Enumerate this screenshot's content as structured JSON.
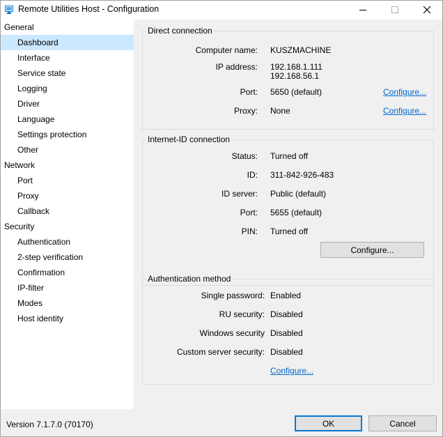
{
  "window": {
    "title": "Remote Utilities Host - Configuration",
    "icon": "remote-utilities-app-icon",
    "controls": [
      "minimize-icon",
      "maximize-icon",
      "close-icon"
    ]
  },
  "sidebar": {
    "items": [
      {
        "label": "General",
        "level": 0
      },
      {
        "label": "Dashboard",
        "level": 1,
        "selected": true
      },
      {
        "label": "Interface",
        "level": 1
      },
      {
        "label": "Service state",
        "level": 1
      },
      {
        "label": "Logging",
        "level": 1
      },
      {
        "label": "Driver",
        "level": 1
      },
      {
        "label": "Language",
        "level": 1
      },
      {
        "label": "Settings protection",
        "level": 1
      },
      {
        "label": "Other",
        "level": 1
      },
      {
        "label": "Network",
        "level": 0
      },
      {
        "label": "Port",
        "level": 1
      },
      {
        "label": "Proxy",
        "level": 1
      },
      {
        "label": "Callback",
        "level": 1
      },
      {
        "label": "Security",
        "level": 0
      },
      {
        "label": "Authentication",
        "level": 1
      },
      {
        "label": "2-step verification",
        "level": 1
      },
      {
        "label": "Confirmation",
        "level": 1
      },
      {
        "label": "IP-filter",
        "level": 1
      },
      {
        "label": "Modes",
        "level": 1
      },
      {
        "label": "Host identity",
        "level": 1
      }
    ]
  },
  "direct_connection": {
    "title": "Direct connection",
    "computer_name_label": "Computer name:",
    "computer_name": "KUSZMACHINE",
    "ip_label": "IP address:",
    "ip_1": "192.168.1.111",
    "ip_2": "192.168.56.1",
    "port_label": "Port:",
    "port": "5650 (default)",
    "port_configure": "Configure...",
    "proxy_label": "Proxy:",
    "proxy": "None",
    "proxy_configure": "Configure..."
  },
  "internet_id": {
    "title": "Internet-ID connection",
    "status_label": "Status:",
    "status": "Turned off",
    "id_label": "ID:",
    "id": "311-842-926-483",
    "server_label": "ID server:",
    "server": "Public (default)",
    "port_label": "Port:",
    "port": "5655 (default)",
    "pin_label": "PIN:",
    "pin": "Turned off",
    "configure_button": "Configure..."
  },
  "auth_method": {
    "title": "Authentication method",
    "single_password_label": "Single password:",
    "single_password": "Enabled",
    "ru_security_label": "RU security:",
    "ru_security": "Disabled",
    "windows_security_label": "Windows security",
    "windows_security": "Disabled",
    "custom_server_label": "Custom server security:",
    "custom_server": "Disabled",
    "configure": "Configure..."
  },
  "footer": {
    "version": "Version 7.1.7.0 (70170)",
    "ok": "OK",
    "cancel": "Cancel"
  },
  "colors": {
    "selection": "#cce8ff",
    "link": "#0066cc",
    "panel": "#f0f0f0",
    "default_button_border": "#0078d7"
  }
}
